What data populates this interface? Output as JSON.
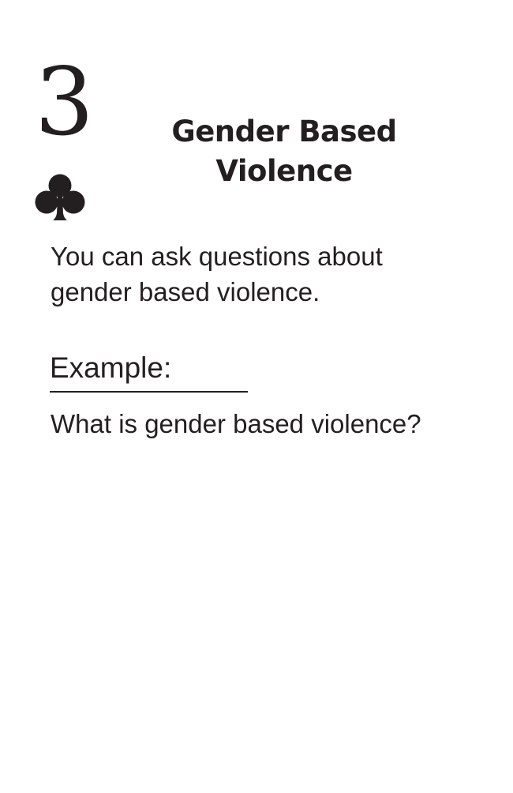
{
  "card": {
    "rank": "3",
    "suit_icon": "club-icon",
    "title_line1": "Gender Based",
    "title_line2": "Violence",
    "body_line1": "You can ask questions about",
    "body_line2": "gender based violence.",
    "example_label": "Example:",
    "example_text": "What is gender based violence?"
  },
  "colors": {
    "ink": "#231f20",
    "background": "#ffffff"
  }
}
